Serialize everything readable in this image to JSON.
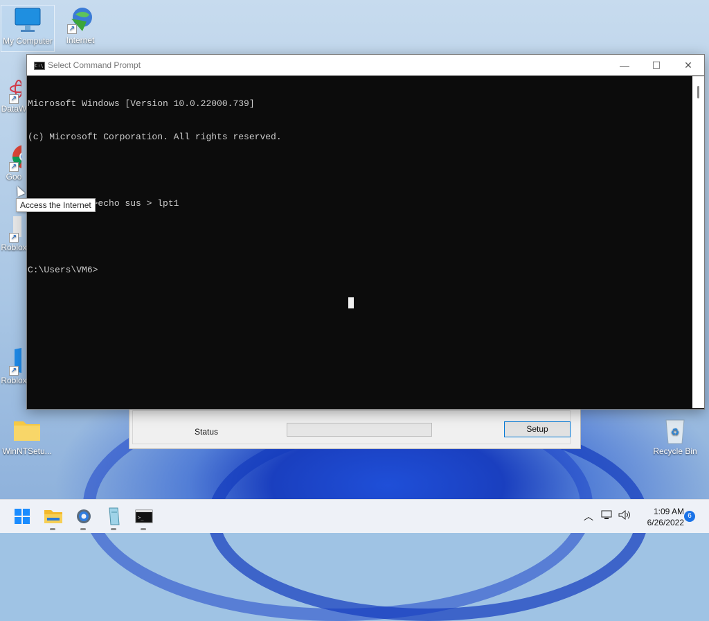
{
  "desktop": {
    "icons": [
      {
        "label": "My Computer"
      },
      {
        "label": "Internet"
      },
      {
        "label": "DataW"
      },
      {
        "label": "Goo"
      },
      {
        "label": "Roblox"
      },
      {
        "label": "Roblox"
      },
      {
        "label": "WinNTSetu..."
      },
      {
        "label": "Recycle Bin"
      }
    ]
  },
  "tooltip": {
    "text": "Access the Internet"
  },
  "cmd_window": {
    "title": "Select Command Prompt",
    "lines": [
      "Microsoft Windows [Version 10.0.22000.739]",
      "(c) Microsoft Corporation. All rights reserved.",
      "",
      "C:\\Users\\VM6>echo sus > lpt1",
      "",
      "C:\\Users\\VM6>"
    ],
    "minimize": "—",
    "maximize": "☐",
    "close": "✕"
  },
  "setup_window": {
    "status_label": "Status",
    "progress": 0,
    "setup_button": "Setup"
  },
  "taskbar": {
    "clock_time": "1:09 AM",
    "clock_date": "6/26/2022",
    "notification_count": "6",
    "apps": [
      "start-icon",
      "file-explorer-icon",
      "settings-icon",
      "notepad-icon",
      "command-prompt-icon"
    ]
  },
  "colors": {
    "console_bg": "#0c0c0c",
    "console_fg": "#cccccc",
    "accent": "#0078d7"
  }
}
